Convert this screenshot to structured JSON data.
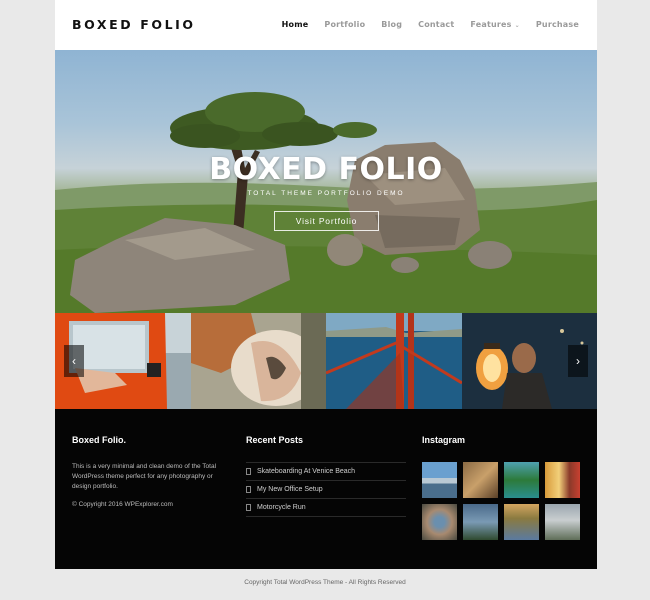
{
  "header": {
    "logo": "BOXED FOLIO",
    "nav": [
      {
        "label": "Home"
      },
      {
        "label": "Portfolio"
      },
      {
        "label": "Blog"
      },
      {
        "label": "Contact"
      },
      {
        "label": "Features"
      },
      {
        "label": "Purchase"
      }
    ]
  },
  "hero": {
    "title": "BOXED FOLIO",
    "subtitle": "TOTAL THEME PORTFOLIO DEMO",
    "button": "Visit Portfolio"
  },
  "slider": {
    "prev_icon": "chevron-left-icon",
    "next_icon": "chevron-right-icon"
  },
  "footer": {
    "about": {
      "title": "Boxed Folio.",
      "text": "This is a very minimal and clean demo of the Total WordPress theme perfect for any photography or design portfolio.",
      "copyright": "© Copyright 2016 WPExplorer.com"
    },
    "recent_posts": {
      "title": "Recent Posts",
      "posts": [
        "Skateboarding At Venice Beach",
        "My New Office Setup",
        "Motorcycle Run"
      ]
    },
    "instagram": {
      "title": "Instagram"
    }
  },
  "bottom": {
    "copyright": "Copyright Total WordPress Theme - All Rights Reserved"
  }
}
